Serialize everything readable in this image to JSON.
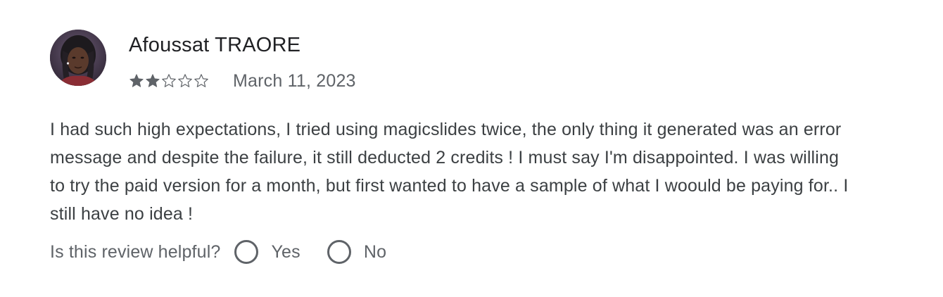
{
  "review": {
    "author": "Afoussat TRAORE",
    "avatar": "avatar-photo",
    "rating": {
      "value": 2,
      "max": 5,
      "filled_color": "#5f6368",
      "empty_color": "#5f6368"
    },
    "date": "March 11, 2023",
    "text": "I had such high expectations, I tried using magicslides twice, the only thing it generated was an error message and despite the failure, it still deducted 2 credits ! I must say I'm disappointed. I was willing to try the paid version for a month, but first wanted to have a sample of what I woould be paying for.. I still have no idea !",
    "helpful": {
      "question": "Is this review helpful?",
      "yes_label": "Yes",
      "no_label": "No"
    }
  },
  "colors": {
    "text_primary": "#202124",
    "text_secondary": "#5f6368",
    "text_body": "#3c4043"
  }
}
